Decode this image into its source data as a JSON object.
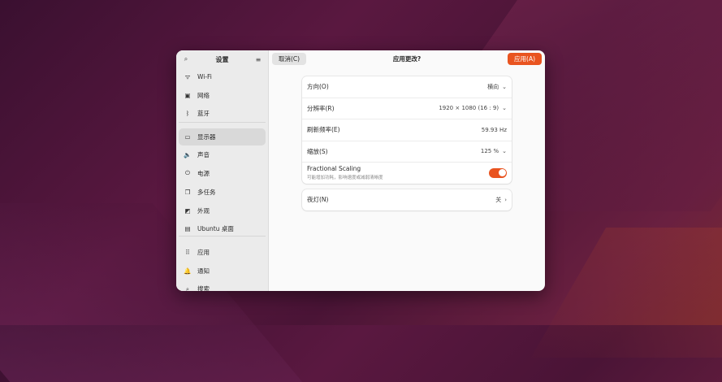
{
  "sidebar": {
    "title": "设置",
    "items": [
      {
        "label": "Wi-Fi",
        "icon": "wifi-icon",
        "glyph": "ᯤ"
      },
      {
        "label": "网络",
        "icon": "network-icon",
        "glyph": "▣"
      },
      {
        "label": "蓝牙",
        "icon": "bluetooth-icon",
        "glyph": "ᛒ"
      },
      {
        "label": "显示器",
        "icon": "display-icon",
        "glyph": "▭",
        "selected": true
      },
      {
        "label": "声音",
        "icon": "sound-icon",
        "glyph": "🔈"
      },
      {
        "label": "电源",
        "icon": "power-icon",
        "glyph": "⏻"
      },
      {
        "label": "多任务",
        "icon": "multitasking-icon",
        "glyph": "❐"
      },
      {
        "label": "外观",
        "icon": "appearance-icon",
        "glyph": "◩"
      },
      {
        "label": "Ubuntu 桌面",
        "icon": "ubuntu-desktop-icon",
        "glyph": "▤"
      },
      {
        "label": "应用",
        "icon": "apps-icon",
        "glyph": "⠿"
      },
      {
        "label": "通知",
        "icon": "bell-icon",
        "glyph": "🔔"
      },
      {
        "label": "搜索",
        "icon": "search-icon",
        "glyph": "⌕"
      }
    ]
  },
  "header": {
    "cancel_label": "取消(C)",
    "title": "应用更改?",
    "apply_label": "应用(A)"
  },
  "display": {
    "orientation": {
      "label": "方向(O)",
      "value": "横向"
    },
    "resolution": {
      "label": "分辨率(R)",
      "value": "1920 × 1080 (16 : 9)"
    },
    "refresh": {
      "label": "刷新频率(E)",
      "value": "59.93 Hz"
    },
    "scale": {
      "label": "缩放(S)",
      "value": "125 %"
    },
    "fractional": {
      "label": "Fractional Scaling",
      "subtitle": "可能增加功耗，影响速度或减弱清晰度",
      "enabled": true
    }
  },
  "night_light": {
    "label": "夜灯(N)",
    "value": "关"
  },
  "colors": {
    "accent": "#e95420"
  }
}
